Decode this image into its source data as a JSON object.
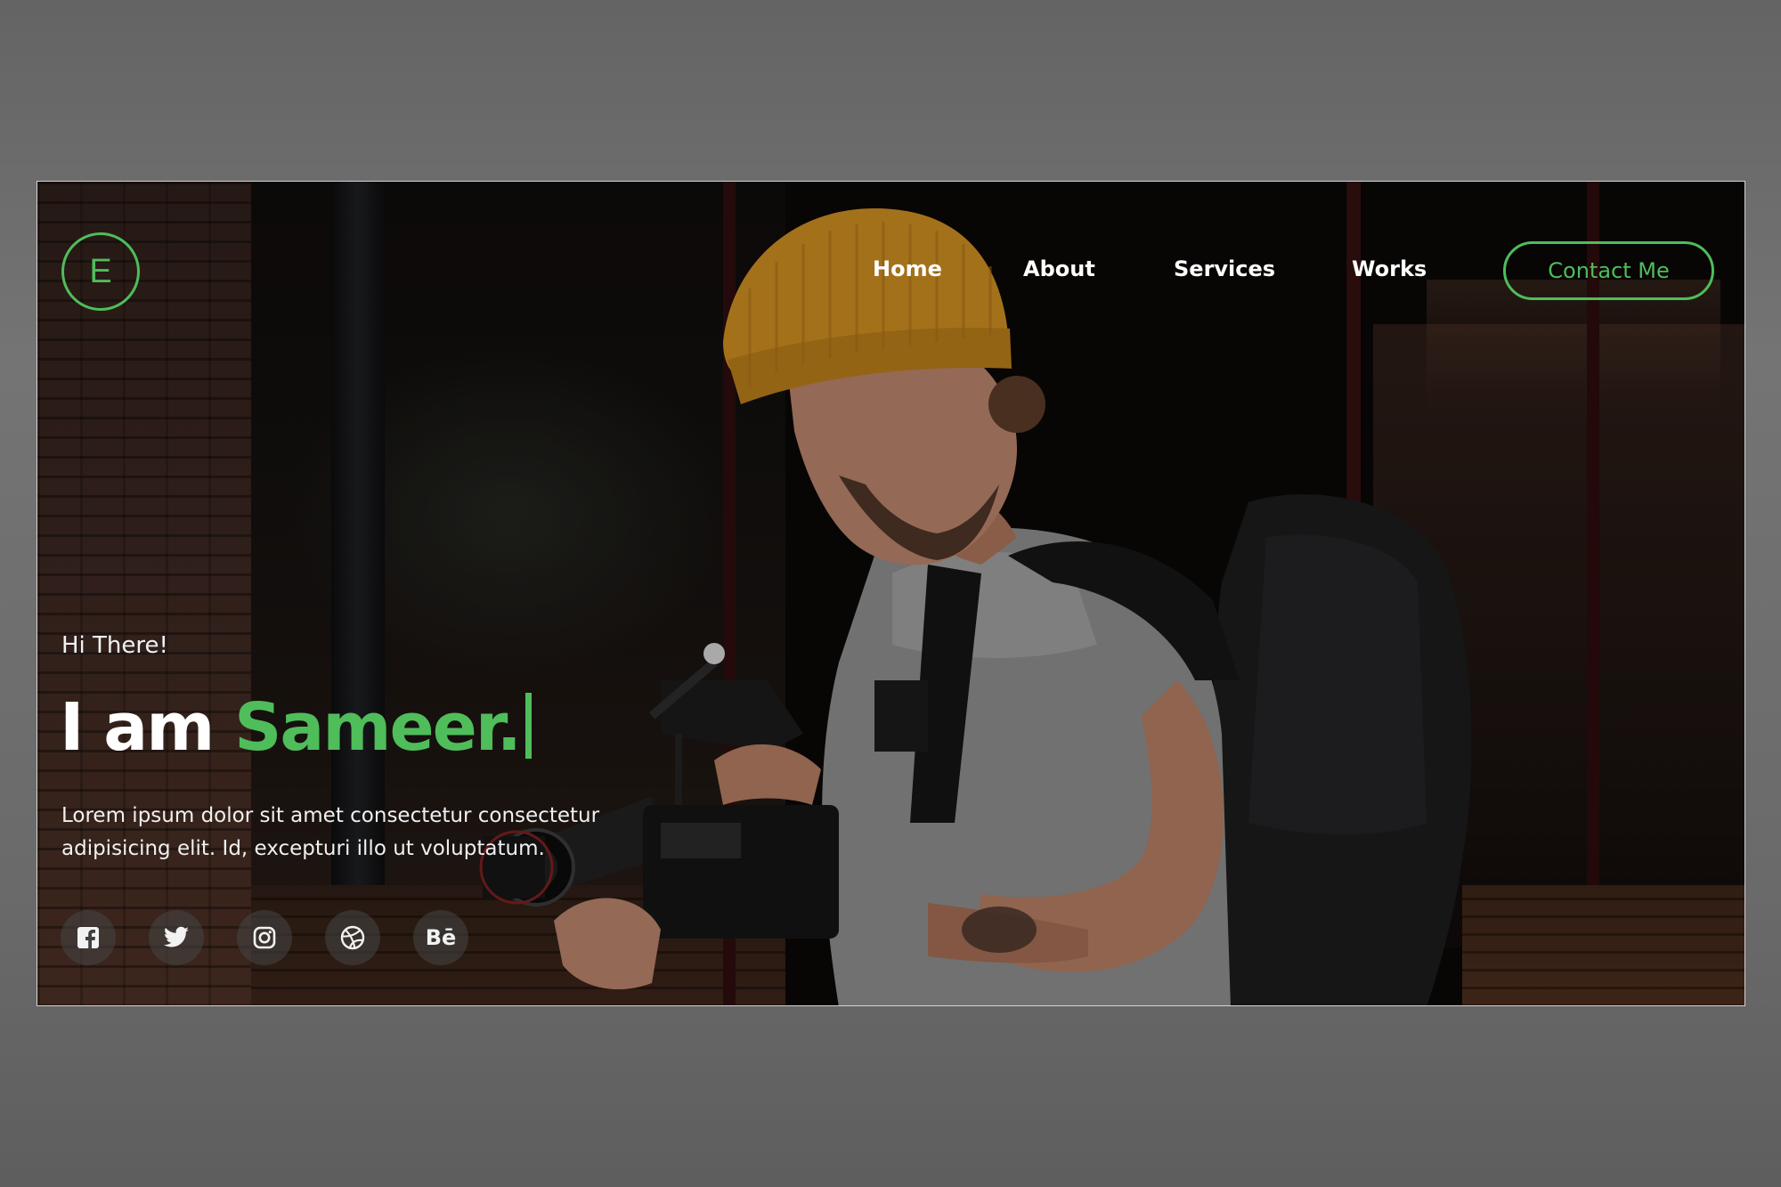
{
  "logo": {
    "letter": "E"
  },
  "nav": {
    "items": [
      {
        "label": "Home"
      },
      {
        "label": "About"
      },
      {
        "label": "Services"
      },
      {
        "label": "Works"
      }
    ],
    "cta_label": "Contact Me"
  },
  "hero": {
    "greeting": "Hi There!",
    "headline_prefix": "I am",
    "headline_name": "Sameer.",
    "description": "Lorem ipsum dolor sit amet consectetur consectetur adipisicing elit. Id, excepturi illo ut voluptatum."
  },
  "social": {
    "icons": [
      "facebook-icon",
      "twitter-icon",
      "instagram-icon",
      "dribbble-icon",
      "behance-icon"
    ],
    "behance_text": "Bē"
  },
  "colors": {
    "accent": "#4fbd5a",
    "text": "#ffffff",
    "page_background": "#6b6b6b"
  }
}
